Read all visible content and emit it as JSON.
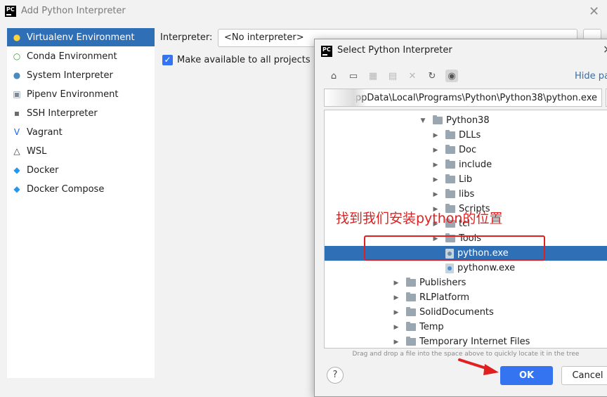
{
  "main_window": {
    "title": "Add Python Interpreter",
    "sidebar": [
      {
        "label": "Virtualenv Environment",
        "icon": "python-icon",
        "selected": true
      },
      {
        "label": "Conda Environment",
        "icon": "conda-icon"
      },
      {
        "label": "System Interpreter",
        "icon": "python-icon"
      },
      {
        "label": "Pipenv Environment",
        "icon": "pipenv-icon"
      },
      {
        "label": "SSH Interpreter",
        "icon": "ssh-icon"
      },
      {
        "label": "Vagrant",
        "icon": "vagrant-icon"
      },
      {
        "label": "WSL",
        "icon": "linux-icon"
      },
      {
        "label": "Docker",
        "icon": "docker-icon"
      },
      {
        "label": "Docker Compose",
        "icon": "docker-icon"
      }
    ],
    "interpreter_label": "Interpreter:",
    "interpreter_value": "<No interpreter>",
    "make_available_label": "Make available to all projects",
    "make_available_checked": true
  },
  "dialog": {
    "title": "Select Python Interpreter",
    "hide_path_label": "Hide pa",
    "path": "\\AppData\\Local\\Programs\\Python\\Python38\\python.exe",
    "path_more": "...",
    "toolbar": [
      "home-icon",
      "desktop-icon",
      "project-icon",
      "new-folder-icon",
      "delete-icon",
      "refresh-icon",
      "show-hidden-icon"
    ],
    "tree": [
      {
        "label": "Python38",
        "indent": 2,
        "expanded": true,
        "type": "folder"
      },
      {
        "label": "DLLs",
        "indent": 3,
        "type": "folder"
      },
      {
        "label": "Doc",
        "indent": 3,
        "type": "folder"
      },
      {
        "label": "include",
        "indent": 3,
        "type": "folder"
      },
      {
        "label": "Lib",
        "indent": 3,
        "type": "folder"
      },
      {
        "label": "libs",
        "indent": 3,
        "type": "folder"
      },
      {
        "label": "Scripts",
        "indent": 3,
        "type": "folder"
      },
      {
        "label": "tcl",
        "indent": 3,
        "type": "folder"
      },
      {
        "label": "Tools",
        "indent": 3,
        "type": "folder"
      },
      {
        "label": "python.exe",
        "indent": 3,
        "type": "file",
        "selected": true
      },
      {
        "label": "pythonw.exe",
        "indent": 3,
        "type": "file"
      },
      {
        "label": "Publishers",
        "indent": 1,
        "type": "folder"
      },
      {
        "label": "RLPlatform",
        "indent": 1,
        "type": "folder"
      },
      {
        "label": "SolidDocuments",
        "indent": 1,
        "type": "folder"
      },
      {
        "label": "Temp",
        "indent": 1,
        "type": "folder"
      },
      {
        "label": "Temporary Internet Files",
        "indent": 1,
        "type": "folder"
      }
    ],
    "drag_hint": "Drag and drop a file into the space above to quickly locate it in the tree",
    "help_label": "?",
    "ok_label": "OK",
    "cancel_label": "Cancel"
  },
  "annotation": {
    "text": "找到我们安装python的位置",
    "color": "#e02020"
  },
  "colors": {
    "selection": "#2f6fb6",
    "accent": "#3574f0"
  }
}
